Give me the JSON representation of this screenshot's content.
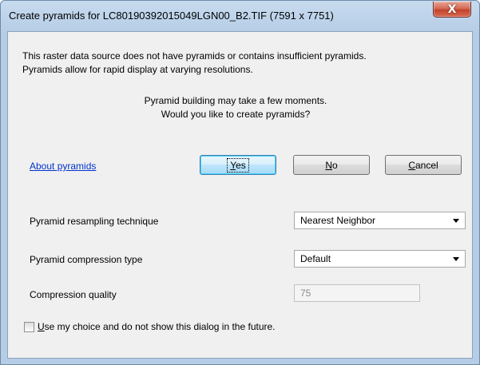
{
  "window": {
    "title": "Create pyramids for LC80190392015049LGN00_B2.TIF (7591 x 7751)",
    "close_glyph": "X"
  },
  "message": {
    "line1": "This raster data source does not have pyramids or contains insufficient pyramids.",
    "line2": "Pyramids allow for rapid display at varying resolutions.",
    "center_line1": "Pyramid building may take a few moments.",
    "center_line2": "Would you like to create pyramids?"
  },
  "about_link": "About pyramids",
  "buttons": {
    "yes": {
      "mnemonic": "Y",
      "rest": "es"
    },
    "no": {
      "mnemonic": "N",
      "rest": "o"
    },
    "cancel": {
      "mnemonic": "C",
      "rest": "ancel"
    }
  },
  "resampling": {
    "label": "Pyramid resampling technique",
    "value": "Nearest Neighbor"
  },
  "compression": {
    "label": "Pyramid compression type",
    "value": "Default"
  },
  "quality": {
    "label": "Compression quality",
    "value": "75"
  },
  "remember": {
    "mnemonic": "U",
    "rest": "se my choice and do not show this dialog in the future.",
    "checked": false
  }
}
